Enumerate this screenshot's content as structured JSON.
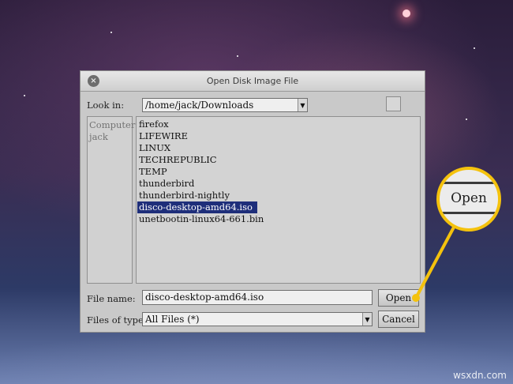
{
  "dialog": {
    "title": "Open Disk Image File",
    "close_label": "×",
    "look_in_label": "Look in:",
    "look_in_value": "/home/jack/Downloads",
    "sidebar_items": [
      "Computer",
      "jack"
    ],
    "files": [
      "firefox",
      "LIFEWIRE",
      "LINUX",
      "TECHREPUBLIC",
      "TEMP",
      "thunderbird",
      "thunderbird-nightly",
      "disco-desktop-amd64.iso",
      "unetbootin-linux64-661.bin"
    ],
    "selected_file": "disco-desktop-amd64.iso",
    "file_name_label": "File name:",
    "file_name_value": "disco-desktop-amd64.iso",
    "files_of_type_label": "Files of type:",
    "files_of_type_value": "All Files (*)",
    "open_label": "Open",
    "cancel_label": "Cancel"
  },
  "callout": {
    "label": "Open"
  },
  "watermark": "wsxdn.com",
  "colors": {
    "highlight": "#f4c20d",
    "selection": "#1e2e7a"
  },
  "icons": {
    "close": "close-icon",
    "dropdown": "chevron-down-icon",
    "new_folder": "new-folder-icon"
  }
}
